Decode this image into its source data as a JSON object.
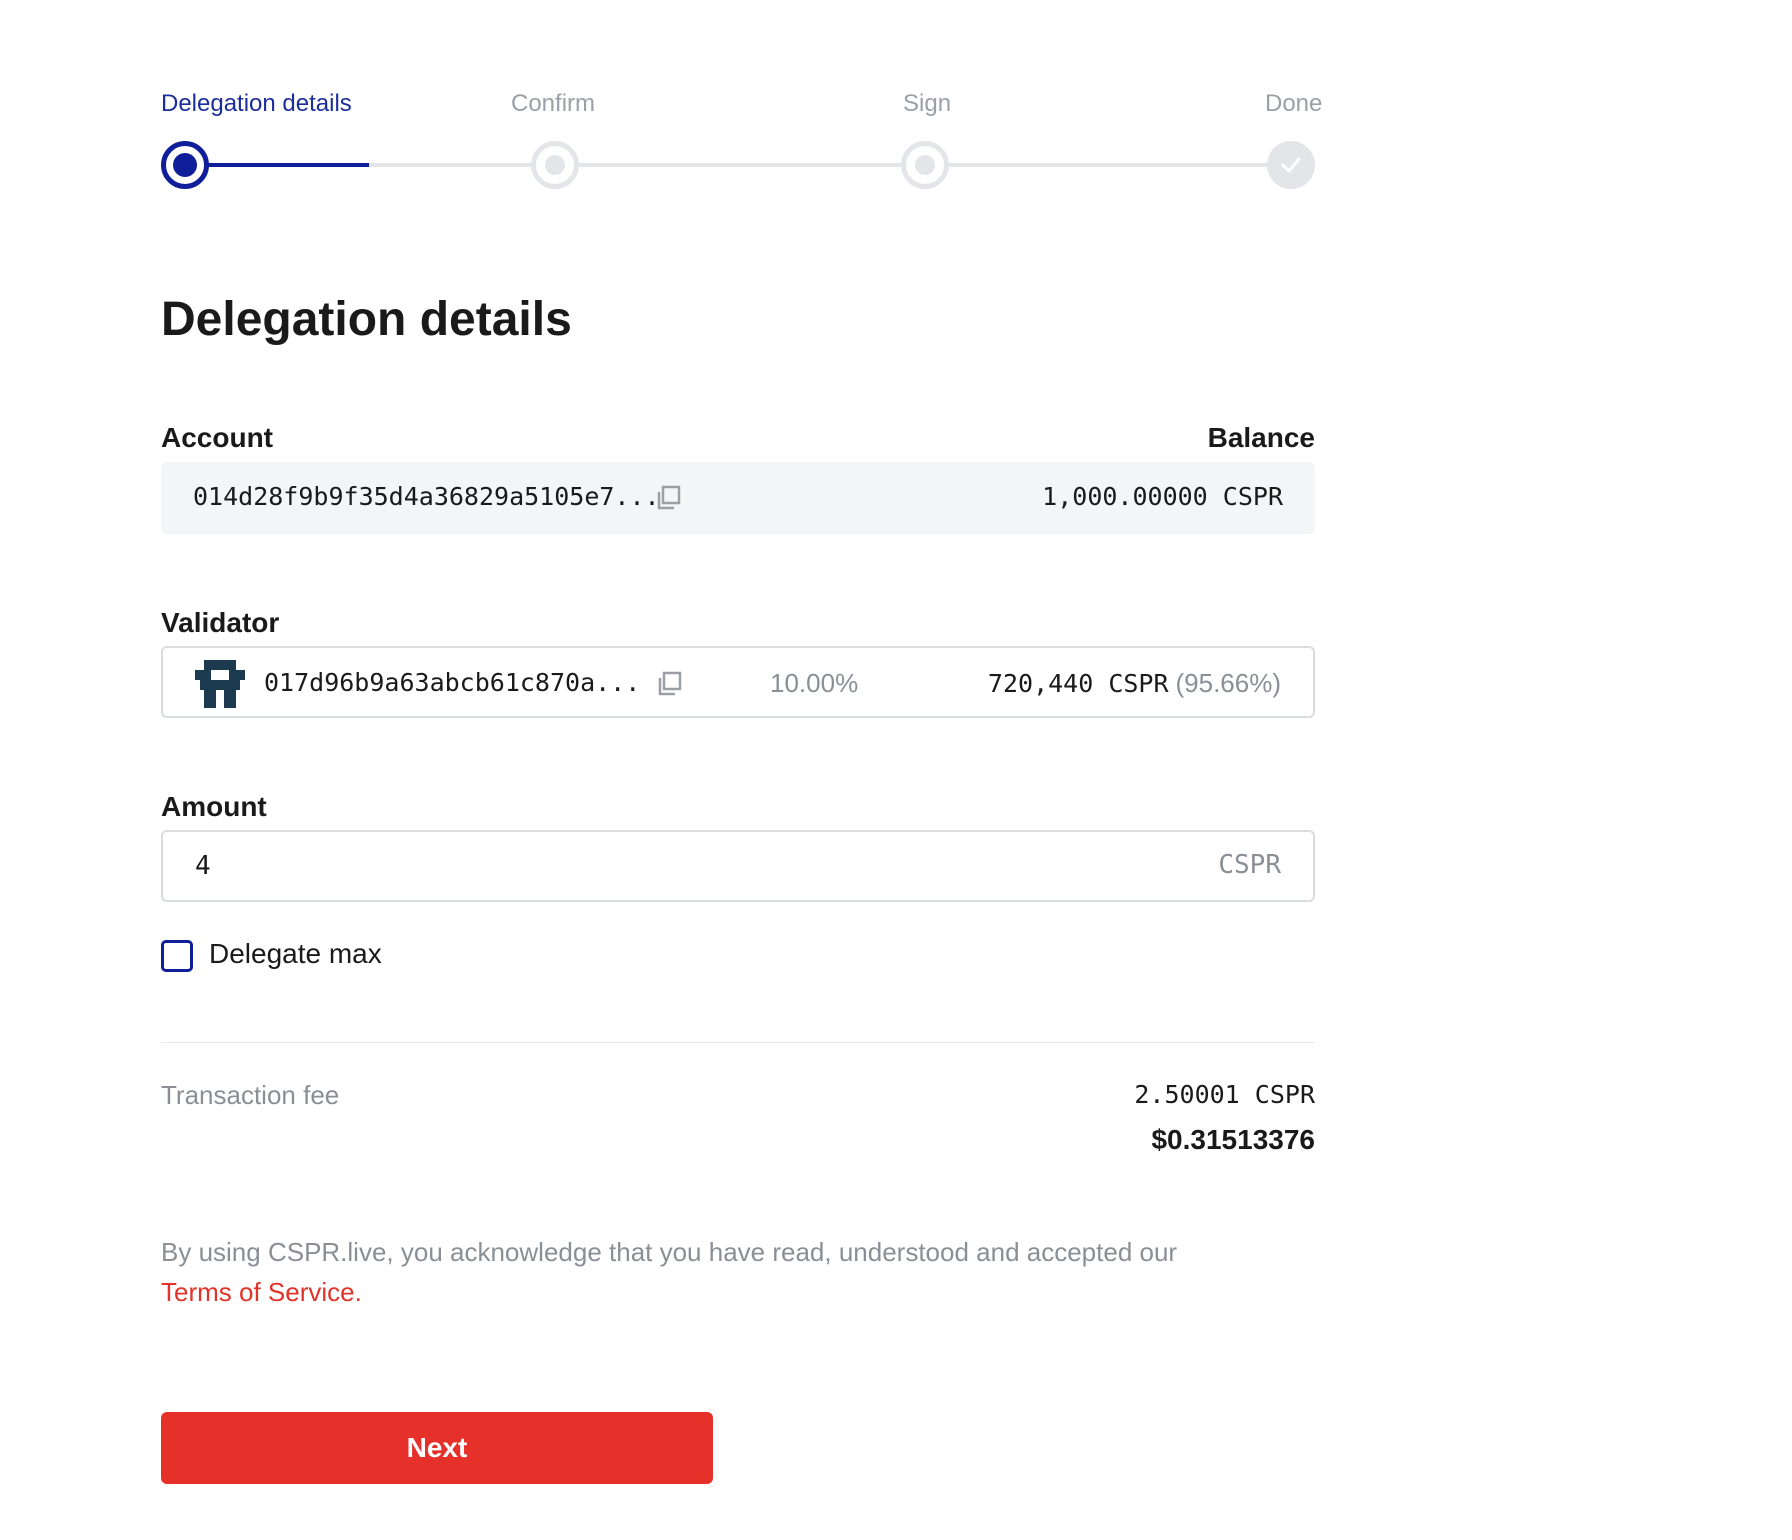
{
  "stepper": {
    "steps": [
      {
        "label": "Delegation details",
        "state": "active"
      },
      {
        "label": "Confirm",
        "state": "pending"
      },
      {
        "label": "Sign",
        "state": "pending"
      },
      {
        "label": "Done",
        "state": "done"
      }
    ]
  },
  "page": {
    "title": "Delegation details"
  },
  "account": {
    "label": "Account",
    "balance_label": "Balance",
    "hash": "014d28f9b9f35d4a36829a5105e7...",
    "balance": "1,000.00000 CSPR"
  },
  "validator": {
    "label": "Validator",
    "hash": "017d96b9a63abcb61c870a...",
    "fee": "10.00%",
    "stake": "720,440 CSPR",
    "stake_percent": "(95.66%)"
  },
  "amount": {
    "label": "Amount",
    "value": "4",
    "unit": "CSPR"
  },
  "delegate_max": {
    "label": "Delegate max",
    "checked": false
  },
  "transaction_fee": {
    "label": "Transaction fee",
    "cspr": "2.50001 CSPR",
    "usd": "$0.31513376"
  },
  "disclaimer": {
    "text": "By using CSPR.live, you acknowledge that you have read, understood and accepted our",
    "link": "Terms of Service."
  },
  "next_button": {
    "label": "Next"
  },
  "colors": {
    "accent": "#0f1f99",
    "primary_button": "#e5312a",
    "link": "#e2332b",
    "muted_text": "#8a8f96"
  }
}
